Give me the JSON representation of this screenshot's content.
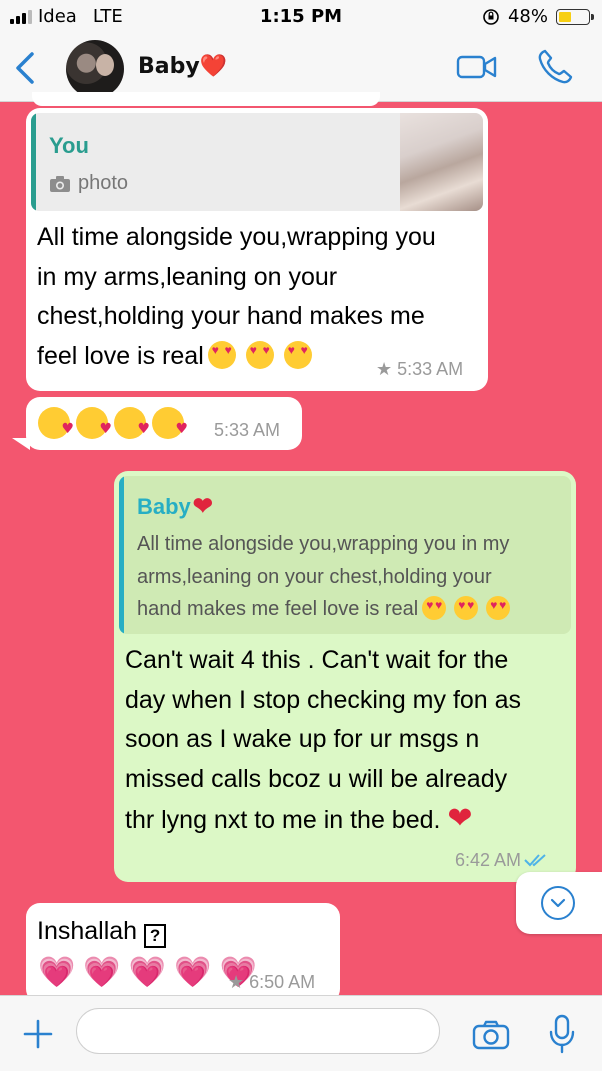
{
  "status_bar": {
    "carrier": "Idea",
    "network": "LTE",
    "time": "1:15 PM",
    "battery": "48%",
    "battery_level": 0.48
  },
  "header": {
    "contact_name": "Baby❤️"
  },
  "messages": {
    "m1": {
      "quote_author": "You",
      "quote_type": "photo",
      "text": "All time alongside you,wrapping you\nin my arms,leaning on your\nchest,holding your hand makes me\nfeel love is real",
      "time": "★ 5:33 AM"
    },
    "m2": {
      "time": "5:33 AM"
    },
    "m3": {
      "quote_author": "Baby",
      "quote_text": "All time alongside you,wrapping you in my\narms,leaning on your chest,holding your\nhand makes me feel love is real",
      "text": "Can't wait 4 this . Can't wait for the\nday when I stop checking my fon as\nsoon as I wake up for ur msgs n\nmissed calls bcoz u will be already\nthr lyng nxt to me in the bed.",
      "time": "6:42 AM"
    },
    "m4": {
      "text": "Inshallah",
      "time": "★ 6:50 AM"
    }
  },
  "colors": {
    "wallpaper": "#f3566f",
    "accent_blue": "#2a81cf",
    "outgoing_bubble": "#dcf8c6",
    "incoming_bubble": "#ffffff"
  },
  "icons": [
    "back-chevron",
    "video-call",
    "phone-call",
    "camera",
    "photo-camera",
    "double-check",
    "scroll-down-chevron",
    "plus",
    "microphone",
    "question-box"
  ]
}
